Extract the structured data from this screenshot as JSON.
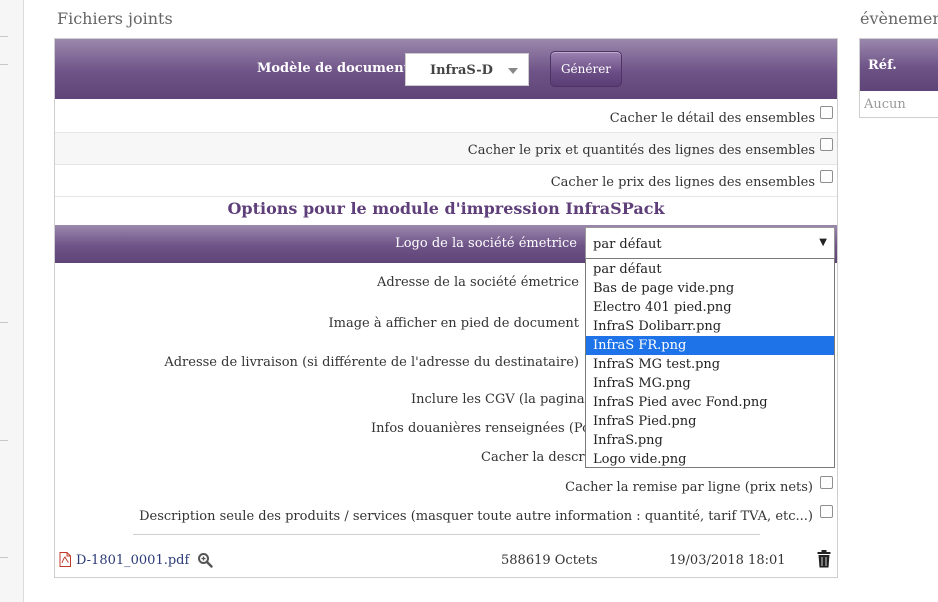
{
  "sections": {
    "attached_files_title": "Fichiers joints",
    "events_title": "évènement"
  },
  "generate": {
    "model_label": "Modèle de document",
    "model_value": "InfraS-D",
    "button_label": "Générer"
  },
  "options": {
    "hide_detail_sets": "Cacher le détail des ensembles",
    "hide_price_qty_sets": "Cacher le prix et quantités des lignes des ensembles",
    "hide_price_lines_sets": "Cacher le prix des lignes des ensembles"
  },
  "infraspack": {
    "title": "Options pour le module d'impression InfraSPack",
    "logo_label": "Logo de la société émetrice",
    "logo_selected": "par défaut",
    "logo_arrow": "▼",
    "logo_options": [
      "par défaut",
      "Bas de page vide.png",
      "Electro 401 pied.png",
      "InfraS Dolibarr.png",
      "InfraS FR.png",
      "InfraS MG test.png",
      "InfraS MG.png",
      "InfraS Pied avec Fond.png",
      "InfraS Pied.png",
      "InfraS.png",
      "Logo vide.png"
    ],
    "highlighted_option": "InfraS FR.png",
    "issuer_address_label": "Adresse de la société émetrice",
    "footer_image_label": "Image à afficher en pied de document",
    "delivery_address_label": "Adresse de livraison (si différente de l'adresse du destinataire)",
    "include_cgv_label": "Inclure les CGV (la paginati",
    "customs_info_label": "Infos douanières renseignées (Poi",
    "hide_description_label": "Cacher la descri",
    "hide_discount_label": "Cacher la remise par ligne (prix nets)",
    "description_only_label": "Description seule des produits / services (masquer toute autre information : quantité, tarif TVA, etc...)"
  },
  "file": {
    "name": "D-1801_0001.pdf",
    "size": "588619 Octets",
    "date": "19/03/2018 18:01"
  },
  "events": {
    "ref_header": "Réf.",
    "empty": "Aucun"
  },
  "colors": {
    "purple_dark": "#5f4477",
    "purple_light": "#9b88ad",
    "title_purple": "#5f3f7a",
    "highlight_blue": "#1e73e8",
    "link_blue": "#2b3b78"
  }
}
